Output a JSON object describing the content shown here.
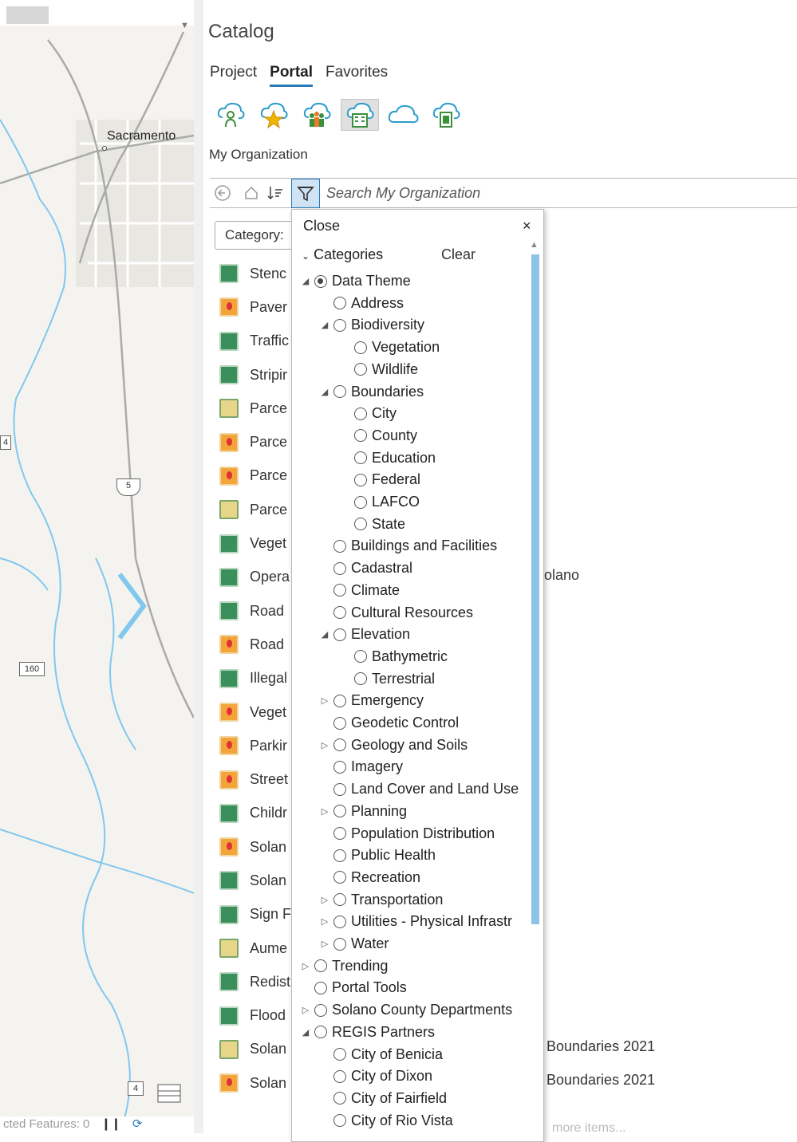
{
  "map": {
    "city_label": "Sacramento",
    "shields": {
      "interstate": "5",
      "route160": "160",
      "route4": "4",
      "route4b": "4"
    },
    "status_text": "cted Features: 0"
  },
  "catalog": {
    "title": "Catalog",
    "tabs": [
      {
        "label": "Project",
        "active": false
      },
      {
        "label": "Portal",
        "active": true
      },
      {
        "label": "Favorites",
        "active": false
      }
    ],
    "portal_icons": [
      "my-content-icon",
      "favorites-icon",
      "groups-icon",
      "organization-icon",
      "arcgis-online-icon",
      "living-atlas-icon"
    ],
    "section_label": "My Organization",
    "search_placeholder": "Search My Organization",
    "category_dropdown": "Category:",
    "items": [
      {
        "label": "Stenc",
        "icon": "layer"
      },
      {
        "label": "Paver",
        "icon": "feature"
      },
      {
        "label": "Traffic",
        "icon": "layer"
      },
      {
        "label": "Stripir",
        "icon": "layer"
      },
      {
        "label": "Parce",
        "icon": "map"
      },
      {
        "label": "Parce",
        "icon": "feature"
      },
      {
        "label": "Parce",
        "icon": "feature"
      },
      {
        "label": "Parce",
        "icon": "map"
      },
      {
        "label": "Veget",
        "icon": "layer"
      },
      {
        "label": "Opera",
        "icon": "layer"
      },
      {
        "label": "Road",
        "icon": "layer"
      },
      {
        "label": "Road",
        "icon": "feature"
      },
      {
        "label": "Illegal",
        "icon": "layer"
      },
      {
        "label": "Veget",
        "icon": "feature"
      },
      {
        "label": "Parkir",
        "icon": "feature"
      },
      {
        "label": "Street",
        "icon": "feature"
      },
      {
        "label": "Childr",
        "icon": "layer"
      },
      {
        "label": "Solan",
        "icon": "feature"
      },
      {
        "label": "Solan",
        "icon": "layer"
      },
      {
        "label": "Sign F",
        "icon": "layer"
      },
      {
        "label": "Aume",
        "icon": "map"
      },
      {
        "label": "Redist",
        "icon": "layer"
      },
      {
        "label": "Flood",
        "icon": "layer"
      },
      {
        "label": "Solan",
        "icon": "map"
      },
      {
        "label": "Solan",
        "icon": "feature"
      }
    ],
    "right_texts": {
      "solano": "olano",
      "boundaries1": "Boundaries 2021",
      "boundaries2": "Boundaries 2021",
      "more": "more items..."
    }
  },
  "filter_popup": {
    "close_label": "Close",
    "close_x": "×",
    "categories_label": "Categories",
    "clear_label": "Clear",
    "tree": [
      {
        "label": "Data Theme",
        "level": 0,
        "expander": "open",
        "checked": true
      },
      {
        "label": "Address",
        "level": 1,
        "expander": "none",
        "checked": false
      },
      {
        "label": "Biodiversity",
        "level": 1,
        "expander": "open",
        "checked": false
      },
      {
        "label": "Vegetation",
        "level": 2,
        "expander": "none",
        "checked": false
      },
      {
        "label": "Wildlife",
        "level": 2,
        "expander": "none",
        "checked": false
      },
      {
        "label": "Boundaries",
        "level": 1,
        "expander": "open",
        "checked": false
      },
      {
        "label": "City",
        "level": 2,
        "expander": "none",
        "checked": false
      },
      {
        "label": "County",
        "level": 2,
        "expander": "none",
        "checked": false
      },
      {
        "label": "Education",
        "level": 2,
        "expander": "none",
        "checked": false
      },
      {
        "label": "Federal",
        "level": 2,
        "expander": "none",
        "checked": false
      },
      {
        "label": "LAFCO",
        "level": 2,
        "expander": "none",
        "checked": false
      },
      {
        "label": "State",
        "level": 2,
        "expander": "none",
        "checked": false
      },
      {
        "label": "Buildings and Facilities",
        "level": 1,
        "expander": "none",
        "checked": false
      },
      {
        "label": "Cadastral",
        "level": 1,
        "expander": "none",
        "checked": false
      },
      {
        "label": "Climate",
        "level": 1,
        "expander": "none",
        "checked": false
      },
      {
        "label": "Cultural Resources",
        "level": 1,
        "expander": "none",
        "checked": false
      },
      {
        "label": "Elevation",
        "level": 1,
        "expander": "open",
        "checked": false
      },
      {
        "label": "Bathymetric",
        "level": 2,
        "expander": "none",
        "checked": false
      },
      {
        "label": "Terrestrial",
        "level": 2,
        "expander": "none",
        "checked": false
      },
      {
        "label": "Emergency",
        "level": 1,
        "expander": "closed",
        "checked": false
      },
      {
        "label": "Geodetic Control",
        "level": 1,
        "expander": "none",
        "checked": false
      },
      {
        "label": "Geology and Soils",
        "level": 1,
        "expander": "closed",
        "checked": false
      },
      {
        "label": "Imagery",
        "level": 1,
        "expander": "none",
        "checked": false
      },
      {
        "label": "Land Cover and Land Use",
        "level": 1,
        "expander": "none",
        "checked": false
      },
      {
        "label": "Planning",
        "level": 1,
        "expander": "closed",
        "checked": false
      },
      {
        "label": "Population Distribution",
        "level": 1,
        "expander": "none",
        "checked": false
      },
      {
        "label": "Public Health",
        "level": 1,
        "expander": "none",
        "checked": false
      },
      {
        "label": "Recreation",
        "level": 1,
        "expander": "none",
        "checked": false
      },
      {
        "label": "Transportation",
        "level": 1,
        "expander": "closed",
        "checked": false
      },
      {
        "label": "Utilities - Physical Infrastr",
        "level": 1,
        "expander": "closed",
        "checked": false
      },
      {
        "label": "Water",
        "level": 1,
        "expander": "closed",
        "checked": false
      },
      {
        "label": "Trending",
        "level": 0,
        "expander": "closed",
        "checked": false
      },
      {
        "label": "Portal Tools",
        "level": 0,
        "expander": "none",
        "checked": false
      },
      {
        "label": "Solano County Departments",
        "level": 0,
        "expander": "closed",
        "checked": false
      },
      {
        "label": "REGIS Partners",
        "level": 0,
        "expander": "open",
        "checked": false
      },
      {
        "label": "City of Benicia",
        "level": 1,
        "expander": "none",
        "checked": false
      },
      {
        "label": "City of Dixon",
        "level": 1,
        "expander": "none",
        "checked": false
      },
      {
        "label": "City of Fairfield",
        "level": 1,
        "expander": "none",
        "checked": false
      },
      {
        "label": "City of Rio Vista",
        "level": 1,
        "expander": "none",
        "checked": false
      }
    ]
  }
}
